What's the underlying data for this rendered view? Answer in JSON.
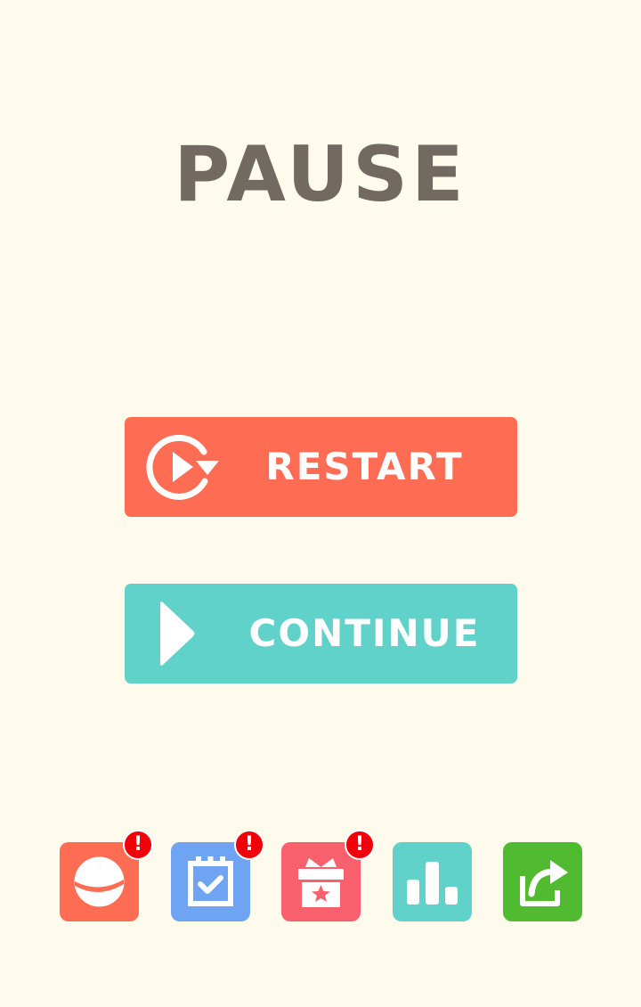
{
  "title": "PAUSE",
  "buttons": {
    "restart": {
      "label": "RESTART",
      "icon": "restart-icon",
      "color": "#FF6C54"
    },
    "continue": {
      "label": "CONTINUE",
      "icon": "play-icon",
      "color": "#61D2C9"
    }
  },
  "dock": [
    {
      "icon": "planet-icon",
      "color": "#FF6C54",
      "badge": "!"
    },
    {
      "icon": "calendar-check-icon",
      "color": "#6FA4F2",
      "badge": "!"
    },
    {
      "icon": "gift-icon",
      "color": "#F9606E",
      "badge": "!"
    },
    {
      "icon": "leaderboard-icon",
      "color": "#61D2C9"
    },
    {
      "icon": "share-icon",
      "color": "#50BA30"
    }
  ],
  "colors": {
    "background": "#FEFAEC",
    "title": "#726961"
  }
}
